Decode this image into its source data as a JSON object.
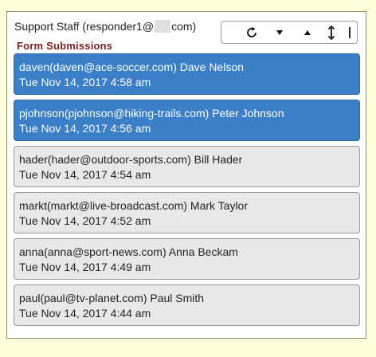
{
  "header": {
    "user_prefix": "Support Staff (responder1@",
    "user_suffix": "com)"
  },
  "section": {
    "title": "Form Submissions"
  },
  "toolbar": {
    "icons": [
      "refresh-icon",
      "arrow-down-icon",
      "arrow-up-icon",
      "expand-vertical-icon",
      "collapse-line-icon"
    ]
  },
  "submissions": [
    {
      "title": "daven(daven@ace-soccer.com) Dave Nelson",
      "date": "Tue Nov 14, 2017 4:58 am",
      "selected": true
    },
    {
      "title": "pjohnson(pjohnson@hiking-trails.com) Peter Johnson",
      "date": "Tue Nov 14, 2017 4:56 am",
      "selected": true
    },
    {
      "title": "hader(hader@outdoor-sports.com) Bill Hader",
      "date": "Tue Nov 14, 2017 4:54 am",
      "selected": false
    },
    {
      "title": "markt(markt@live-broadcast.com) Mark Taylor",
      "date": "Tue Nov 14, 2017 4:52 am",
      "selected": false
    },
    {
      "title": "anna(anna@sport-news.com) Anna Beckam",
      "date": "Tue Nov 14, 2017 4:49 am",
      "selected": false
    },
    {
      "title": "paul(paul@tv-planet.com) Paul Smith",
      "date": "Tue Nov 14, 2017 4:44 am",
      "selected": false
    }
  ],
  "colors": {
    "background": "#ffffd9",
    "selected": "#3a7fc8",
    "normal": "#e8e8e8",
    "section_title": "#7a1f1f"
  }
}
